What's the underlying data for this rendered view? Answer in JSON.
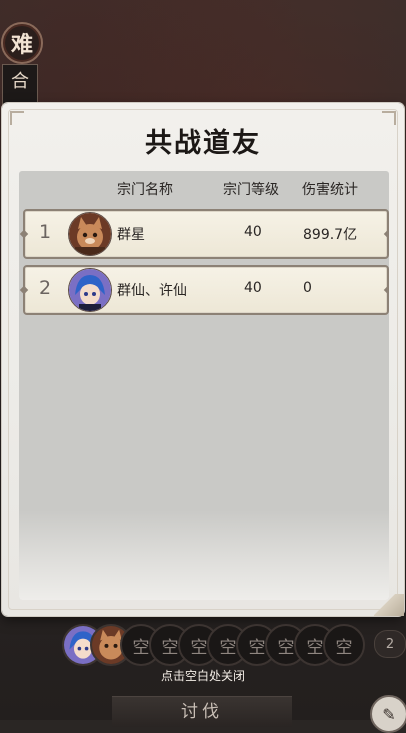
{
  "background": {
    "difficulty_badge": "难",
    "side_tab": "合"
  },
  "panel": {
    "title": "共战道友",
    "columns": {
      "name": "宗门名称",
      "level": "宗门等级",
      "damage": "伤害统计"
    },
    "rows": [
      {
        "rank": "1",
        "name": "群星",
        "level": "40",
        "damage": "899.7亿",
        "avatar": "cat-warrior-avatar"
      },
      {
        "rank": "2",
        "name": "群仙、许仙",
        "level": "40",
        "damage": "0",
        "avatar": "blue-hair-girl-avatar"
      }
    ]
  },
  "bottom": {
    "empty_slot_label": "空",
    "slot_count": "2",
    "close_hint": "点击空白处关闭",
    "attack_button": "讨伐"
  },
  "colors": {
    "panel_bg": "#eceae6",
    "list_bg": "#c9c9c6",
    "row_bg": "#f2ede0",
    "row_border": "#8c8175"
  }
}
